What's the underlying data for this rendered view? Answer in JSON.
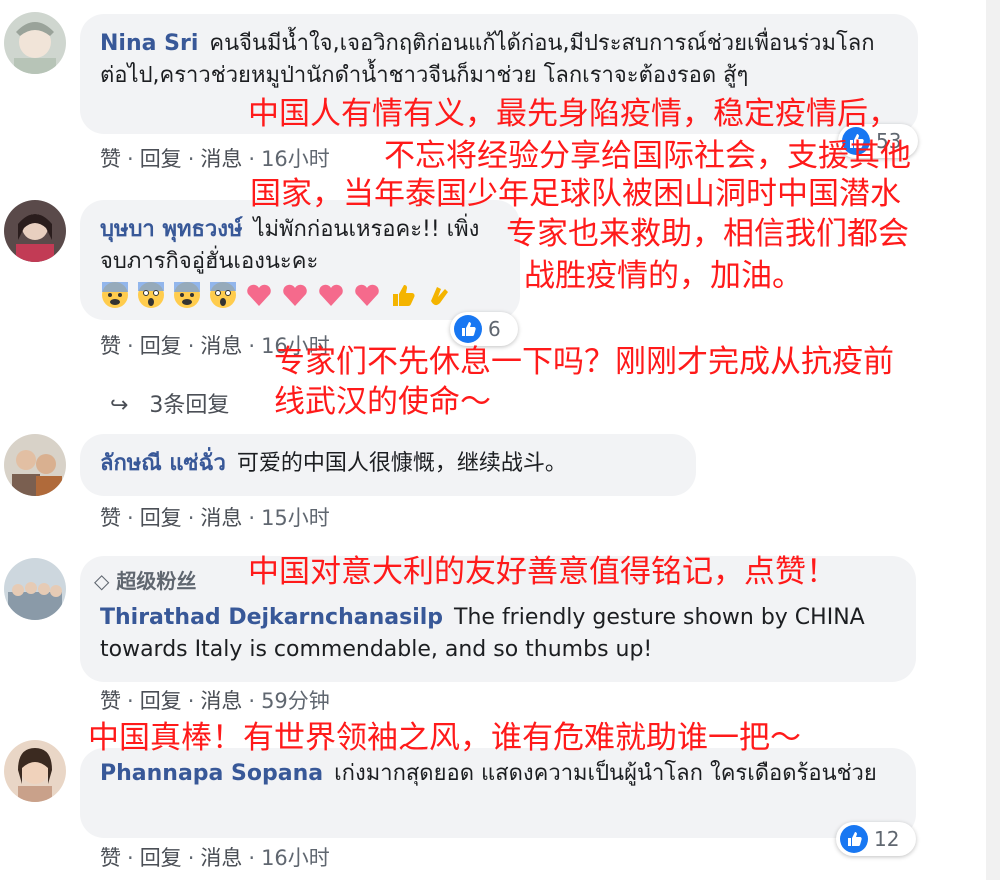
{
  "comments": [
    {
      "author": "Nina Sri",
      "text": "คนจีนมีน้ำใจ,เจอวิกฤติก่อนแก้ได้ก่อน,มีประสบการณ์ช่วยเพื่อนร่วมโลกต่อไป,คราวช่วยหมูป่านักดำน้ำชาวจีนก็มาช่วย โลกเราจะต้องรอด สู้ๆ",
      "like": "赞",
      "reply": "回复",
      "message": "消息",
      "time": "16小时",
      "reactions": "53"
    },
    {
      "author": "บุษบา พุทธวงษ์",
      "text": "ไม่พักก่อนเหรอคะ!! เพิ่งจบภารกิจอู่ฮั่นเองนะคะ",
      "like": "赞",
      "reply": "回复",
      "message": "消息",
      "time": "16小时",
      "reactions": "6",
      "replies_label": "3条回复"
    },
    {
      "author": "ลักษณี แซ่ฉั่ว",
      "text": "可爱的中国人很慷慨，继续战斗。",
      "like": "赞",
      "reply": "回复",
      "message": "消息",
      "time": "15小时"
    },
    {
      "badge": "超级粉丝",
      "author": "Thirathad Dejkarnchanasilp",
      "text": "The friendly gesture shown by CHINA towards Italy is commendable, and so thumbs up!",
      "like": "赞",
      "reply": "回复",
      "message": "消息",
      "time": "59分钟"
    },
    {
      "author": "Phannapa Sopana",
      "text": "เก่งมากสุดยอด แสดงความเป็นผู้นำโลก ใครเดือดร้อนช่วย",
      "like": "赞",
      "reply": "回复",
      "message": "消息",
      "time": "16小时",
      "reactions": "12"
    }
  ],
  "translations": {
    "t1_line1": "中国人有情有义，最先身陷疫情，稳定疫情后，",
    "t1_line2": "不忘将经验分享给国际社会，支援其他",
    "t1_line3": "国家，当年泰国少年足球队被困山洞时中国潜水",
    "t1_line4": "专家也来救助，相信我们都会",
    "t1_line5": "战胜疫情的，加油。",
    "t2_line1": "专家们不先休息一下吗？刚刚才完成从抗疫前",
    "t2_line2": "线武汉的使命～",
    "t4": "中国对意大利的友好善意值得铭记，点赞！",
    "t5": "中国真棒！有世界领袖之风，谁有危难就助谁一把～"
  },
  "colors": {
    "author": "#385898",
    "bubble": "#f2f3f5",
    "overlay": "#ff1a1a",
    "like_blue": "#1877f2"
  }
}
